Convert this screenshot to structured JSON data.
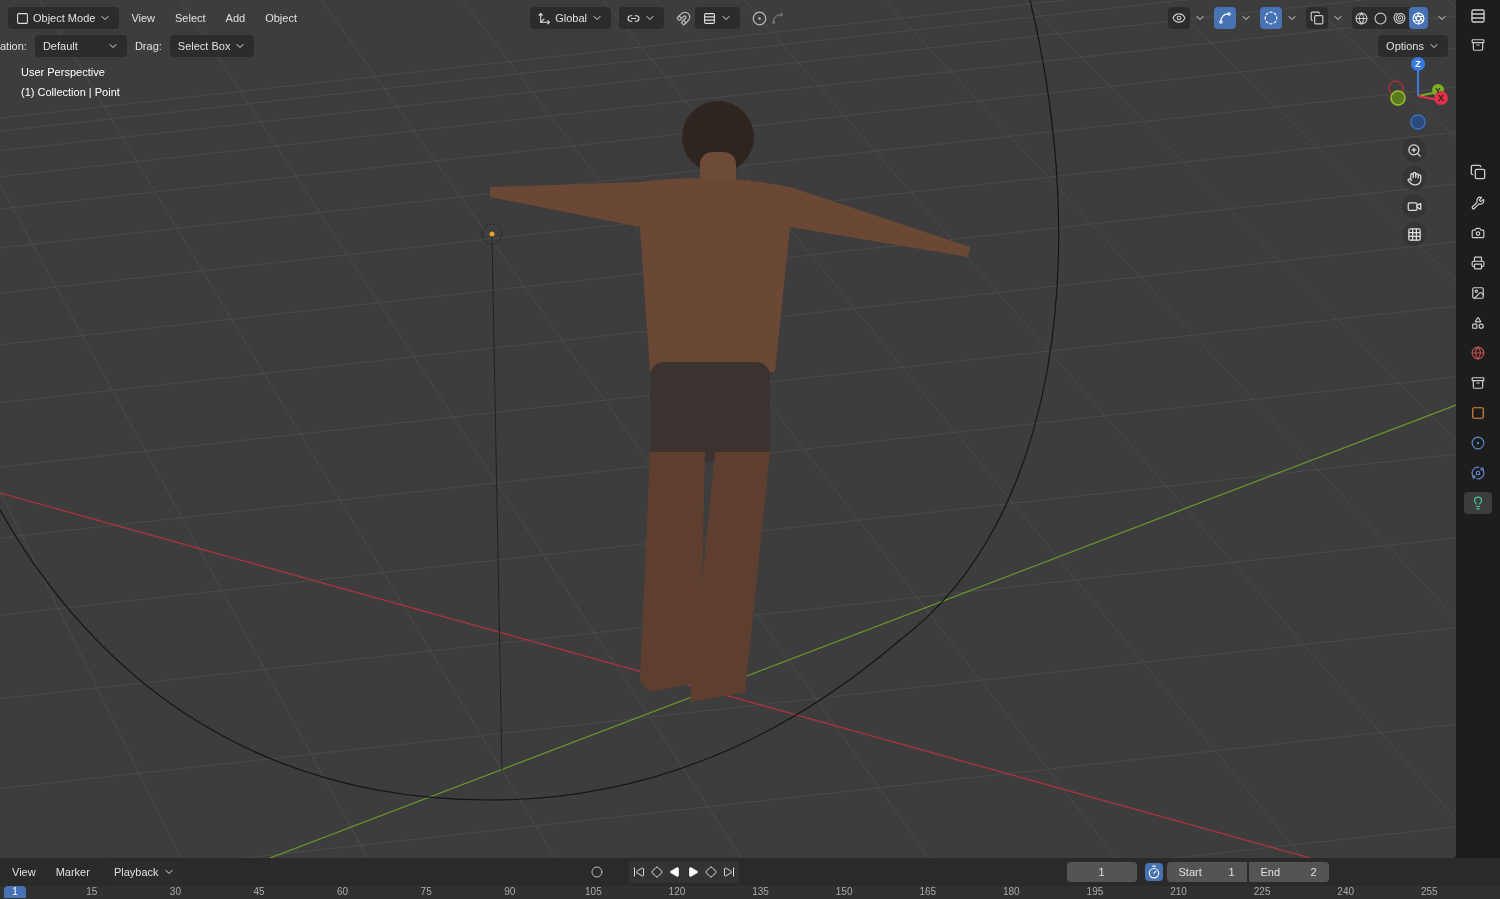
{
  "header": {
    "mode": "Object Mode",
    "menus": [
      "View",
      "Select",
      "Add",
      "Object"
    ],
    "orientation": "Global"
  },
  "viewport_toggles": [
    {
      "kind": "visibility",
      "selected": false
    },
    {
      "kind": "gizmos",
      "selected": true
    },
    {
      "kind": "overlays",
      "selected": true
    },
    {
      "kind": "xray",
      "selected": false
    }
  ],
  "shading_modes": [
    {
      "kind": "wireframe",
      "selected": false
    },
    {
      "kind": "solid",
      "selected": false
    },
    {
      "kind": "material",
      "selected": false
    },
    {
      "kind": "rendered",
      "selected": true
    }
  ],
  "tool_settings": {
    "orientation_label": "ation:",
    "orientation": "Default",
    "drag_label": "Drag:",
    "drag": "Select Box",
    "options": "Options"
  },
  "viewport_info": [
    "User Perspective",
    "(1) Collection | Point"
  ],
  "gizmo": {
    "axes": [
      "Z",
      "Y",
      "X"
    ]
  },
  "properties_tabs": [
    {
      "kind": "tool",
      "selected": false
    },
    {
      "kind": "render",
      "selected": false
    },
    {
      "kind": "output",
      "selected": false
    },
    {
      "kind": "view_layer",
      "selected": false
    },
    {
      "kind": "scene",
      "selected": false
    },
    {
      "kind": "world",
      "selected": false
    },
    {
      "kind": "collection",
      "selected": false
    },
    {
      "kind": "object",
      "selected": false
    },
    {
      "kind": "physics",
      "selected": false
    },
    {
      "kind": "constraints",
      "selected": false
    },
    {
      "kind": "light",
      "selected": true
    }
  ],
  "timeline": {
    "menus": [
      "View",
      "Marker"
    ],
    "playback": "Playback",
    "current_frame": "1",
    "start_label": "Start",
    "start": "1",
    "end_label": "End",
    "end": "2",
    "ruler": [
      {
        "label": "1",
        "selected": true
      },
      {
        "label": "15",
        "selected": false
      },
      {
        "label": "30",
        "selected": false
      },
      {
        "label": "45",
        "selected": false
      },
      {
        "label": "60",
        "selected": false
      },
      {
        "label": "75",
        "selected": false
      },
      {
        "label": "90",
        "selected": false
      },
      {
        "label": "105",
        "selected": false
      },
      {
        "label": "120",
        "selected": false
      },
      {
        "label": "135",
        "selected": false
      },
      {
        "label": "150",
        "selected": false
      },
      {
        "label": "165",
        "selected": false
      },
      {
        "label": "180",
        "selected": false
      },
      {
        "label": "195",
        "selected": false
      },
      {
        "label": "210",
        "selected": false
      },
      {
        "label": "225",
        "selected": false
      },
      {
        "label": "240",
        "selected": false
      },
      {
        "label": "255",
        "selected": false
      }
    ]
  }
}
